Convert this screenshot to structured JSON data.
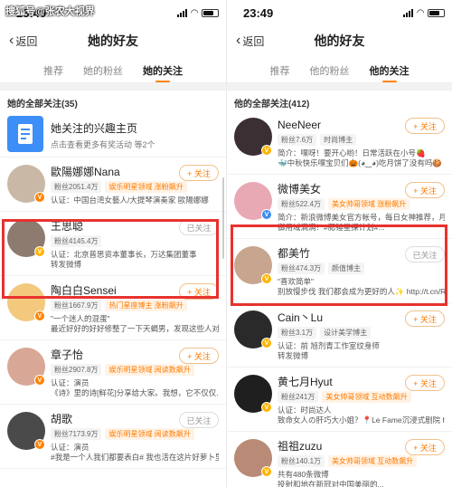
{
  "left": {
    "status_time": "23:49",
    "back_label": "返回",
    "title": "她的好友",
    "tabs": [
      "推荐",
      "她的粉丝",
      "她的关注"
    ],
    "section_title": "她的全部关注(35)",
    "interest": {
      "title": "她关注的兴趣主页",
      "subtitle": "点击查看更多有奖活动 等2个"
    },
    "users": [
      {
        "name": "歐陽娜娜Nana",
        "fans": "粉丝2051.4万",
        "tag": "娱乐明星领域 涨粉飙升",
        "desc": "认证：中国台湾女藝人/大提琴演奏家 歐陽娜娜",
        "btn": "+ 关注",
        "followed": false,
        "avatar": "#c9b8a6",
        "badge": "#ff8200"
      },
      {
        "name": "王思聪",
        "fans": "粉丝4145.4万",
        "tag": "",
        "desc": "认证：北京普思资本董事长，万达集团董事",
        "desc2": "转发微博",
        "btn": "已关注",
        "followed": true,
        "avatar": "#8c7b6e",
        "badge": "#ffb400"
      },
      {
        "name": "陶白白Sensei",
        "fans": "粉丝1667.9万",
        "tag": "热门星座博主 涨粉飙升",
        "desc": "\"一个迷人的混蛋\"",
        "desc2": "最近好好的好好修整了一下天蝎男，发现这些人对于爱...",
        "btn": "+ 关注",
        "followed": false,
        "avatar": "#f2c97d",
        "badge": "#ff8200"
      },
      {
        "name": "章子怡",
        "fans": "粉丝2907.8万",
        "tag": "娱乐明星领域 阅读数飙升",
        "desc": "认证：演员",
        "desc2": "《诗》里的诗[鲜花]分享给大家。我想，它不仅仅...",
        "btn": "+ 关注",
        "followed": false,
        "avatar": "#d9a796",
        "badge": "#ff8200"
      },
      {
        "name": "胡歌",
        "fans": "粉丝7173.9万",
        "tag": "娱乐明星领域 阅读数飙升",
        "desc": "认证：演员",
        "desc2": "#我是一个人我们都要表白# 我也活在这片好萝卜里...",
        "btn": "已关注",
        "followed": true,
        "avatar": "#4a4a4a",
        "badge": "#ff8200"
      }
    ]
  },
  "right": {
    "status_time": "23:49",
    "back_label": "返回",
    "title": "他的好友",
    "tabs": [
      "推荐",
      "他的粉丝",
      "他的关注"
    ],
    "section_title": "他的全部关注(412)",
    "users": [
      {
        "name": "NeeNeer",
        "fans": "粉丝7.6万",
        "tag": "时尚博主",
        "tag_grey": true,
        "desc": "简介：嘿呀！要开心哟！日常活跃在小号🍓",
        "desc2": "🐳中秋快乐嘿宝贝们🎃(◕‿◕)吃月饼了没有吗🍪",
        "btn": "+ 关注",
        "followed": false,
        "avatar": "#3c2f33",
        "badge": "#ffb400"
      },
      {
        "name": "微博美女",
        "fans": "粉丝522.4万",
        "tag": "美女帅哥领域 涨粉飙升",
        "desc": "简介：新浪微博美女官方帐号，每日女神推荐，月...",
        "desc2": "御用域满满！#腮锤星探计划#...",
        "btn": "+ 关注",
        "followed": false,
        "avatar": "#e8a9b4",
        "badge": "#3c8cf0"
      },
      {
        "name": "都美竹",
        "fans": "粉丝474.3万",
        "tag": "颜值博主",
        "tag_grey": true,
        "desc": "\"喜欢简单\"",
        "desc2": "别放慢步伐 我们都会成为更好的人✨ http://t.cn/R...",
        "btn": "已关注",
        "followed": true,
        "avatar": "#c8a58e",
        "badge": "#ffb400"
      },
      {
        "name": "Cain丶Lu",
        "fans": "粉丝3.1万",
        "tag": "设计美学博主",
        "tag_grey": true,
        "desc": "认证：前 旭剂青工作室纹身师",
        "desc2": "转发微博",
        "btn": "+ 关注",
        "followed": false,
        "avatar": "#2a2a2a",
        "badge": "#ffb400"
      },
      {
        "name": "黄七月Hyut",
        "fans": "粉丝241万",
        "tag": "美女帅哥领域 互动数飙升",
        "desc": "认证：时尚达人",
        "desc2": "致命女人の肝巧大小姐？📍Le Fame沉浸式剧院 h...",
        "btn": "+ 关注",
        "followed": false,
        "avatar": "#1f1f1f",
        "badge": "#ffb400"
      },
      {
        "name": "祖祖zuzu",
        "fans": "粉丝140.1万",
        "tag": "美女帅哥领域 互动数飙升",
        "desc": "共有480条微博",
        "desc2": "投射和地在新冠对中国美丽的...",
        "btn": "+ 关注",
        "followed": false,
        "avatar": "#b98b76",
        "badge": "#ffb400"
      }
    ]
  },
  "overlay_text": "搜狐号@张农大视界"
}
